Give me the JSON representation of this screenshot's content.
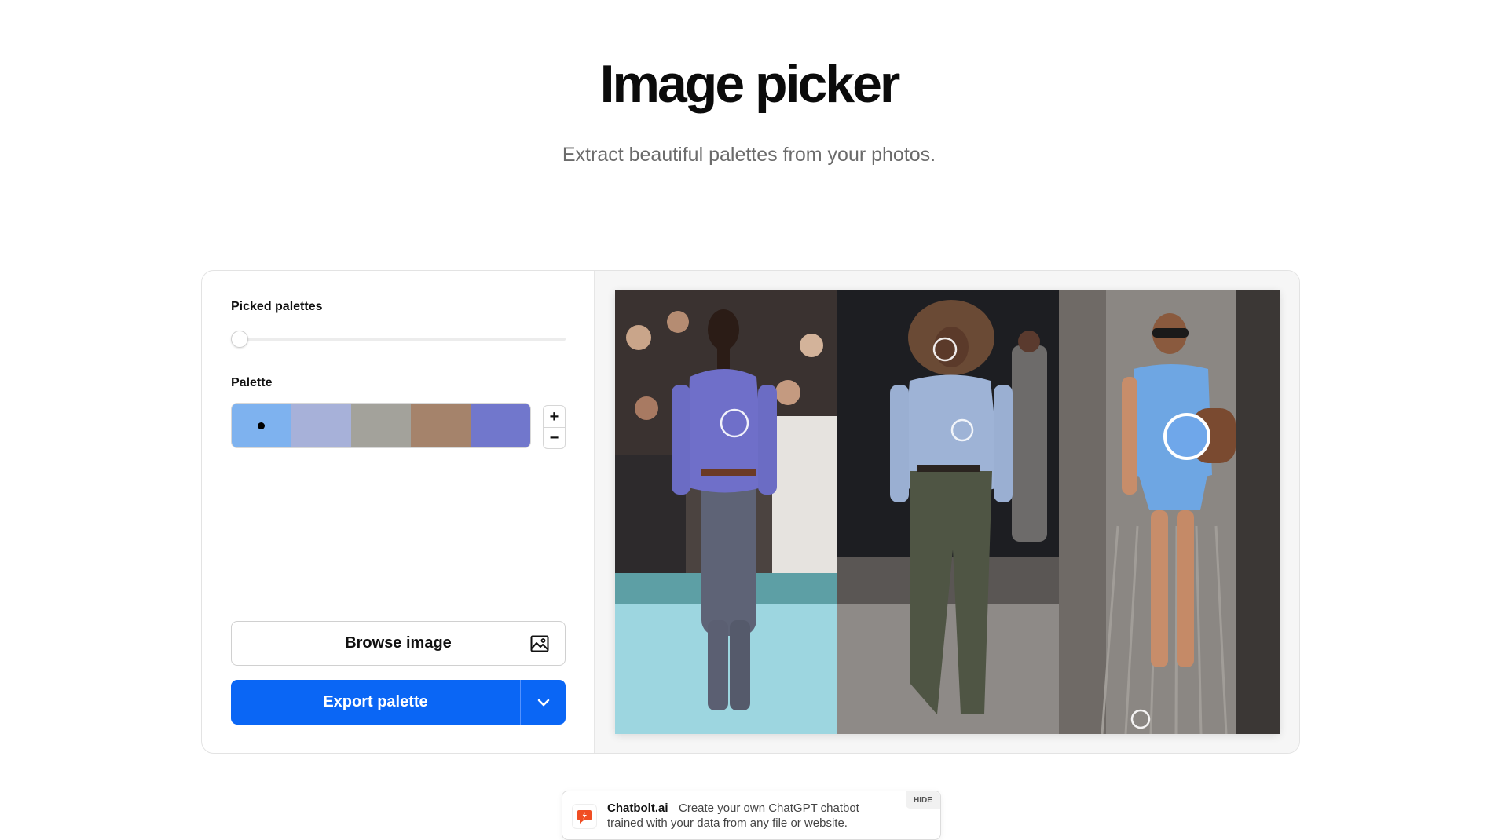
{
  "header": {
    "title": "Image picker",
    "subtitle": "Extract beautiful palettes from your photos."
  },
  "panel": {
    "picked_palettes_label": "Picked palettes",
    "palette_label": "Palette",
    "palette_colors": [
      "#7eb2ef",
      "#a7b1d9",
      "#a3a29b",
      "#a5836b",
      "#7177cc"
    ],
    "selected_swatch": 0,
    "stepper": {
      "increase": "+",
      "decrease": "−"
    },
    "browse_label": "Browse image",
    "export_label": "Export palette",
    "accent_color": "#0a66f5"
  },
  "icons": [
    "image-icon",
    "chevron-down-icon",
    "chatbolt-logo-icon"
  ],
  "chat_widget": {
    "brand": "Chatbolt.ai",
    "line1": "Create your own ChatGPT chatbot",
    "line2": "trained with your data from any file or website.",
    "hide_label": "HIDE"
  }
}
